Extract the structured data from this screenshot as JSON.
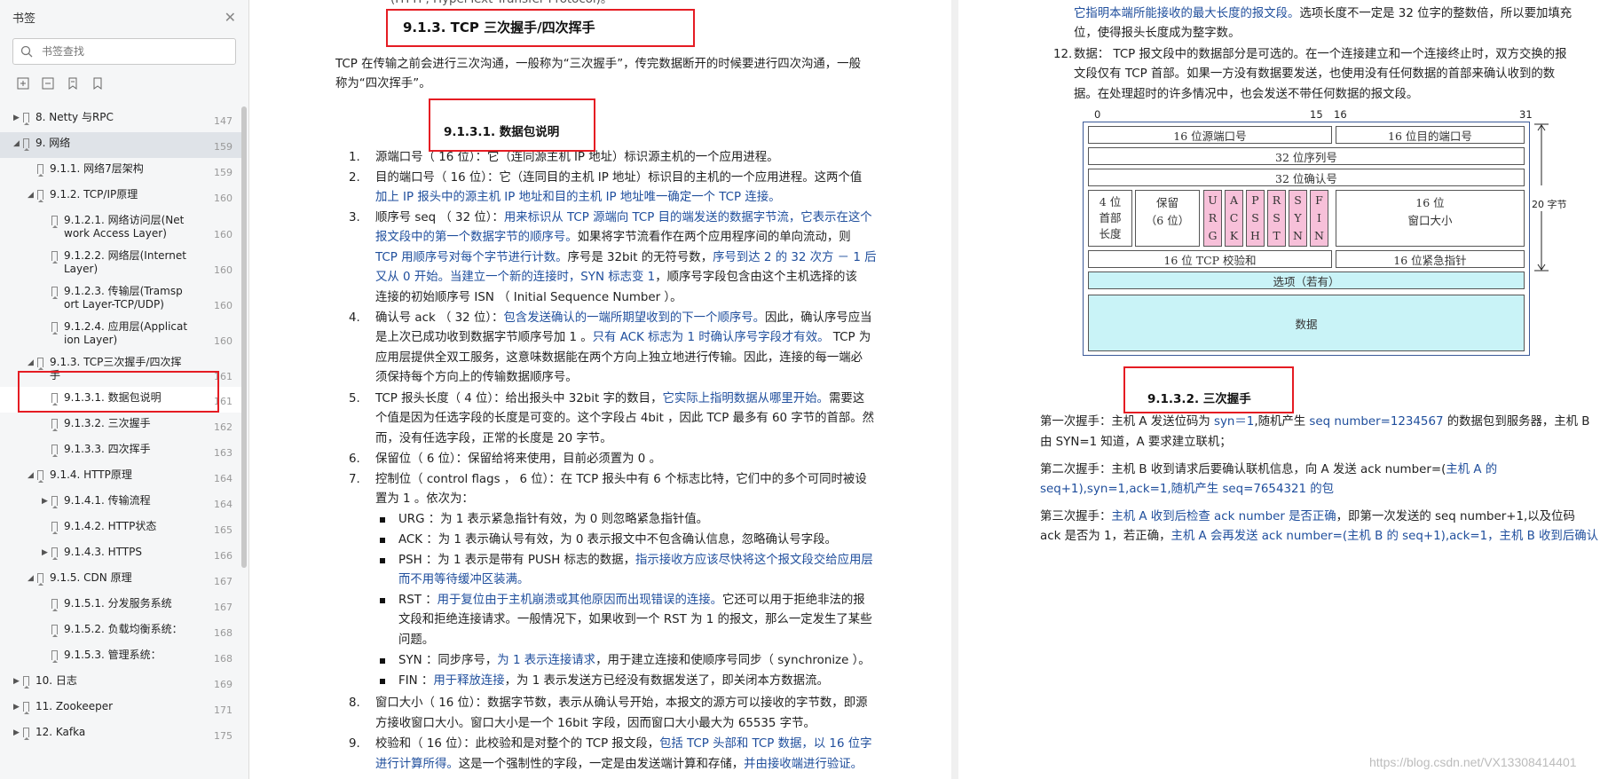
{
  "sidebar": {
    "title": "书签",
    "search_placeholder": "书签查找",
    "items": [
      {
        "label": "8. Netty 与RPC",
        "page": "147"
      },
      {
        "label": "9. 网络",
        "page": "159"
      },
      {
        "label": "9.1.1. 网络7层架构",
        "page": "159"
      },
      {
        "label": "9.1.2. TCP/IP原理",
        "page": "160"
      },
      {
        "label1": "9.1.2.1. 网络访问层(Net",
        "label2": "work Access Layer)",
        "page": "160"
      },
      {
        "label1": "9.1.2.2. 网络层(Internet",
        "label2": "Layer)",
        "page": "160"
      },
      {
        "label1": "9.1.2.3. 传输层(Tramsp",
        "label2": "ort Layer-TCP/UDP)",
        "page": "160"
      },
      {
        "label1": "9.1.2.4. 应用层(Applicat",
        "label2": "ion Layer)",
        "page": "160"
      },
      {
        "label1": "9.1.3. TCP三次握手/四次挥",
        "label2": "手",
        "page": "161"
      },
      {
        "label": "9.1.3.1. 数据包说明",
        "page": "161"
      },
      {
        "label": "9.1.3.2. 三次握手",
        "page": "162"
      },
      {
        "label": "9.1.3.3. 四次挥手",
        "page": "163"
      },
      {
        "label": "9.1.4. HTTP原理",
        "page": "164"
      },
      {
        "label": "9.1.4.1. 传输流程",
        "page": "164"
      },
      {
        "label": "9.1.4.2. HTTP状态",
        "page": "165"
      },
      {
        "label": "9.1.4.3. HTTPS",
        "page": "166"
      },
      {
        "label": "9.1.5. CDN 原理",
        "page": "167"
      },
      {
        "label": "9.1.5.1. 分发服务系统",
        "page": "167"
      },
      {
        "label": "9.1.5.2. 负载均衡系统：",
        "page": "168"
      },
      {
        "label": "9.1.5.3. 管理系统：",
        "page": "168"
      },
      {
        "label": "10. 日志",
        "page": "169"
      },
      {
        "label": "11. Zookeeper",
        "page": "171"
      },
      {
        "label": "12. Kafka",
        "page": "175"
      }
    ]
  },
  "left_page": {
    "top_cut": "(HTTP, HyperText Transfer Protocol)。",
    "heading": "9.1.3.  TCP 三次握手/四次挥手",
    "intro1": "TCP 在传输之前会进行三次沟通，一般称为“三次握手”，传完数据断开的时候要进行四次沟通，一般",
    "intro2": "称为“四次挥手”。",
    "subheading": "9.1.3.1.     数据包说明",
    "l1": "源端口号（ 16 位）：它（连同源主机 IP 地址）标识源主机的一个应用进程。",
    "l2a": "目的端口号（ 16 位）：它（连同目的主机 IP 地址）标识目的主机的一个应用进程。这两个值",
    "l2b": "加上 IP 报头中的源主机 IP 地址和目的主机 IP 地址唯一确定一个 TCP 连接。",
    "l3a1": "顺序号 seq （ 32 位）：",
    "l3a2": "用来标识从 TCP 源端向 TCP 目的端发送的数据字节流，它表示在这个",
    "l3b1": "报文段中的第一个数据字节的顺序号。",
    "l3b2": "如果将字节流看作在两个应用程序间的单向流动，则",
    "l3c1": "TCP 用顺序号对每个字节进行计数。",
    "l3c2": "序号是 32bit 的无符号数，",
    "l3c3": "序号到达 2 的 32 次方 － 1 后",
    "l3d1": "又从 0 开始。当建立一个新的连接时，",
    "l3d2": "SYN 标志变 1",
    "l3d3": "，顺序号字段包含由这个主机选择的该",
    "l3e": "连接的初始顺序号 ISN （ Initial Sequence Number ）。",
    "l4a1": "确认号 ack （ 32 位）：",
    "l4a2": "包含发送确认的一端所期望收到的下一个顺序号。",
    "l4a3": "因此，确认序号应当",
    "l4b1": "是上次已成功收到数据字节顺序号加 1 。",
    "l4b2": "只有 ACK 标志为 1 时确认序号字段才有效。",
    "l4b3": " TCP 为",
    "l4c": "应用层提供全双工服务，这意味数据能在两个方向上独立地进行传输。因此，连接的每一端必",
    "l4d": "须保持每个方向上的传输数据顺序号。",
    "l5a1": "TCP 报头长度（ 4 位）：给出报头中 32bit 字的数目，",
    "l5a2": "它实际上指明数据从哪里开始。",
    "l5a3": "需要这",
    "l5b": "个值是因为任选字段的长度是可变的。这个字段占 4bit ，因此 TCP 最多有 60 字节的首部。然",
    "l5c": "而，没有任选字段，正常的长度是 20 字节。",
    "l6": "保留位（ 6 位）：保留给将来使用，目前必须置为 0 。",
    "l7a": "控制位（ control flags ， 6 位）：在 TCP 报头中有 6 个标志比特，它们中的多个可同时被设",
    "l7b": "置为 1 。依次为：",
    "b1": "URG ：为 1 表示紧急指针有效，为 0 则忽略紧急指针值。",
    "b2": "ACK ：为 1 表示确认号有效，为 0 表示报文中不包含确认信息，忽略确认号字段。",
    "b3a1": "PSH ：为 1 表示是带有 PUSH 标志的数据，",
    "b3a2": "指示接收方应该尽快将这个报文段交给应用层",
    "b3b": "而不用等待缓冲区装满。",
    "b4a1": "RST ：",
    "b4a2": "用于复位由于主机崩溃或其他原因而出现错误的连接。",
    "b4a3": "它还可以用于拒绝非法的报",
    "b4b": "文段和拒绝连接请求。一般情况下，如果收到一个 RST 为 1 的报文，那么一定发生了某些",
    "b4c": "问题。",
    "b5a1": "SYN ：同步序号，",
    "b5a2": "为 1 表示连接请求",
    "b5a3": "，用于建立连接和使顺序号同步（ synchronize ）。",
    "b6a1": "FIN ：",
    "b6a2": "用于释放连接",
    "b6a3": "，为 1 表示发送方已经没有数据发送了，即关闭本方数据流。",
    "l8a": "窗口大小（ 16 位）：数据字节数，表示从确认号开始，本报文的源方可以接收的字节数，即源",
    "l8b": "方接收窗口大小。窗口大小是一个 16bit 字段，因而窗口大小最大为 65535 字节。",
    "l9a1": "校验和（ 16 位）：此校验和是对整个的 TCP 报文段，",
    "l9a2": "包括 TCP 头部和 TCP 数据，以 16 位字",
    "l9b1": "进行计算所得。",
    "l9b2": "这是一个强制性的字段，一定是由发送端计算和存储，",
    "l9b3": "并由接收端进行验证。"
  },
  "right_page": {
    "top1": "它指明本端所能接收的最大长度的报文段。",
    "top1b": "选项长度不一定是 32 位字的整数倍，所以要加填充",
    "top2": "位，使得报头长度成为整字数。",
    "i12a": "数据： TCP 报文段中的数据部分是可选的。在一个连接建立和一个连接终止时，双方交换的报",
    "i12b": "文段仅有 TCP 首部。如果一方没有数据要发送，也使用没有任何数据的首部来确认收到的数",
    "i12c": "据。在处理超时的许多情况中，也会发送不带任何数据的报文段。",
    "diagram": {
      "bit0": "0",
      "bit15": "15",
      "bit16": "16",
      "bit31": "31",
      "src_port": "16 位源端口号",
      "dst_port": "16 位目的端口号",
      "seq": "32 位序列号",
      "ack": "32 位确认号",
      "hdr_len": "4 位\n首部\n长度",
      "reserved": "保留\n（6 位）",
      "flags": [
        [
          "U",
          "R",
          "G"
        ],
        [
          "A",
          "C",
          "K"
        ],
        [
          "P",
          "S",
          "H"
        ],
        [
          "R",
          "S",
          "T"
        ],
        [
          "S",
          "Y",
          "N"
        ],
        [
          "F",
          "I",
          "N"
        ]
      ],
      "window": "16 位\n窗口大小",
      "checksum": "16 位 TCP 校验和",
      "urgent": "16 位紧急指针",
      "options": "选项（若有）",
      "data": "数据",
      "bytes20": "20 字节"
    },
    "subheading": "9.1.3.2.     三次握手",
    "h1a1": "第一次握手：主机 A 发送位码为 ",
    "h1a2": "syn＝1",
    "h1a3": ",随机产生 ",
    "h1a4": "seq  number=1234567",
    "h1a5": " 的数据包到服务器，主机 B",
    "h1b": "由 SYN=1 知道，A 要求建立联机；",
    "h2a1": "第二次握手：主机 B 收到请求后要确认联机信息，向 A 发送 ack number=(",
    "h2a2": "主机 A 的",
    "h2b1": "seq+1),syn=1,ack=1,",
    "h2b2": "随机产生 seq=7654321 的包",
    "h3a1": "第三次握手：",
    "h3a2": "主机 A 收到后检查 ack number 是否正确",
    "h3a3": "，即第一次发送的 seq number+1,以及位码",
    "h3b1": "ack 是否为 1，若正确，",
    "h3b2": "主机 A 会再发送 ack number=(主机 B 的 seq+1),ack=1，主机 B 收到后确认"
  },
  "watermark": "https://blog.csdn.net/VX13308414401",
  "colors": {
    "accent_red": "#e51c23",
    "link_blue": "#1f4e9c",
    "flag_pink": "#f7c0d9",
    "option_cyan": "#c9f3f7"
  }
}
